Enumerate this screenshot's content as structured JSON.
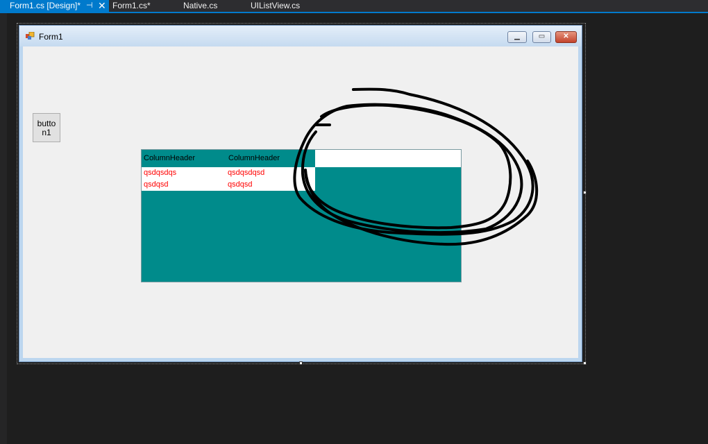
{
  "tabs": [
    {
      "label": "Form1.cs [Design]*",
      "active": true
    },
    {
      "label": "Form1.cs*",
      "active": false
    },
    {
      "label": "Native.cs",
      "active": false
    },
    {
      "label": "UIListView.cs",
      "active": false
    }
  ],
  "tab_icons": {
    "pin": "pin-icon",
    "close": "close-icon"
  },
  "form": {
    "title": "Form1",
    "buttons": {
      "minimize": "minimize-icon",
      "maximize": "maximize-icon",
      "close": "close-icon"
    }
  },
  "button1": {
    "label_line1": "butto",
    "label_line2": "n1"
  },
  "listview": {
    "columns": [
      "ColumnHeader",
      "ColumnHeader"
    ],
    "rows": [
      [
        "qsdqsdqs",
        "qsdqsdqsd"
      ],
      [
        "qsdqsd",
        "qsdqsd"
      ]
    ],
    "back_color": "#008b8b",
    "fore_color": "#ff0000"
  },
  "colors": {
    "accent": "#007acc",
    "ide_background": "#1e1e1e"
  }
}
